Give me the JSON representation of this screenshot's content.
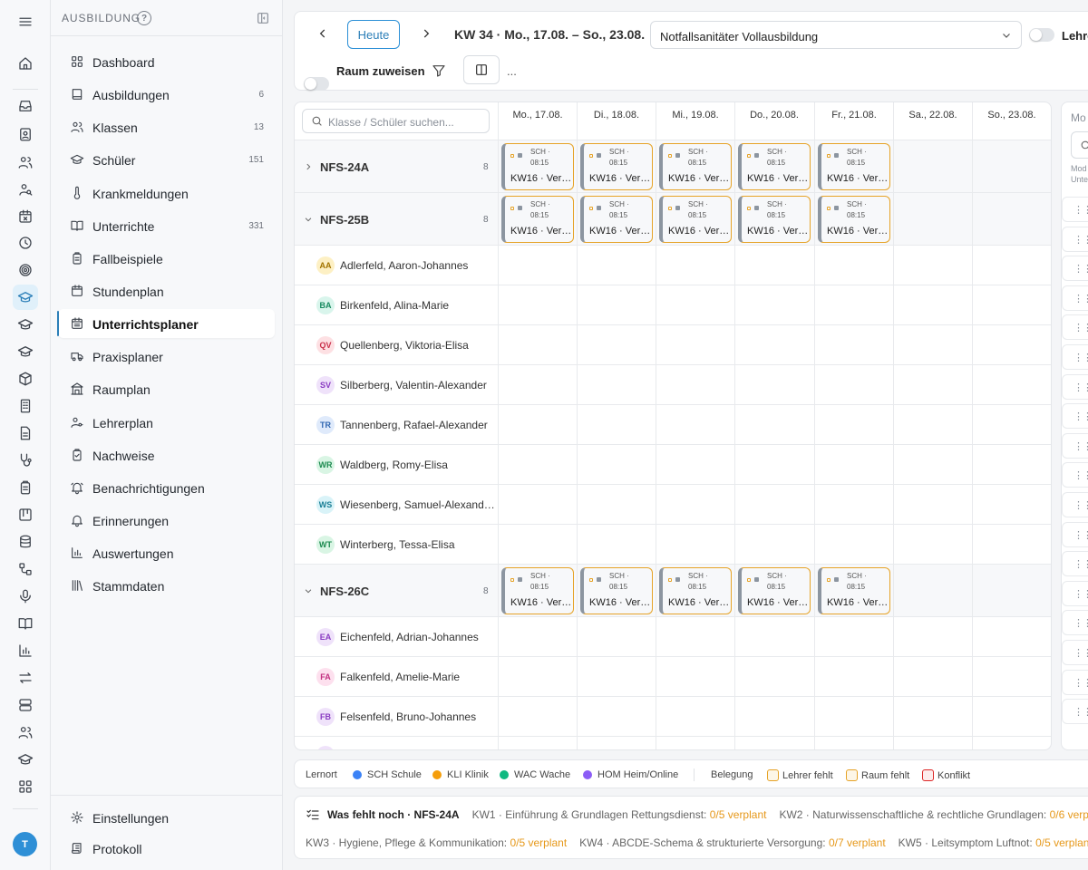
{
  "sidebar": {
    "title": "AUSBILDUNG",
    "items": [
      {
        "label": "Dashboard",
        "count": ""
      },
      {
        "label": "Ausbildungen",
        "count": "6"
      },
      {
        "label": "Klassen",
        "count": "13"
      },
      {
        "label": "Schüler",
        "count": "151"
      },
      {
        "label": "Krankmeldungen",
        "count": ""
      },
      {
        "label": "Unterrichte",
        "count": "331"
      },
      {
        "label": "Fallbeispiele",
        "count": ""
      },
      {
        "label": "Stundenplan",
        "count": ""
      },
      {
        "label": "Unterrichtsplaner",
        "count": ""
      },
      {
        "label": "Praxisplaner",
        "count": ""
      },
      {
        "label": "Raumplan",
        "count": ""
      },
      {
        "label": "Lehrerplan",
        "count": ""
      },
      {
        "label": "Nachweise",
        "count": ""
      },
      {
        "label": "Benachrichtigungen",
        "count": ""
      },
      {
        "label": "Erinnerungen",
        "count": ""
      },
      {
        "label": "Auswertungen",
        "count": ""
      },
      {
        "label": "Stammdaten",
        "count": ""
      }
    ],
    "footer": [
      {
        "label": "Einstellungen"
      },
      {
        "label": "Protokoll"
      }
    ]
  },
  "user": {
    "initial": "T"
  },
  "toolbar": {
    "today": "Heute",
    "week": "KW 34 · Mo., 17.08. – So., 23.08.",
    "course": "Notfallsanitäter Vollausbildung",
    "teacher_toggle": "Lehre",
    "room_toggle": "Raum zuweisen",
    "more": "..."
  },
  "grid": {
    "search_placeholder": "Klasse / Schüler suchen...",
    "days": [
      "Mo., 17.08.",
      "Di., 18.08.",
      "Mi., 19.08.",
      "Do., 20.08.",
      "Fr., 21.08.",
      "Sa., 22.08.",
      "So., 23.08."
    ],
    "chip": {
      "line1": "SCH ·",
      "line2": "08:15",
      "line3": "KW16 · Ver…"
    },
    "groups": [
      {
        "name": "NFS-24A",
        "count": "8",
        "expanded": false,
        "students": []
      },
      {
        "name": "NFS-25B",
        "count": "8",
        "expanded": true,
        "students": [
          {
            "initials": "AA",
            "name": "Adlerfeld, Aaron-Johannes",
            "bg": "#fdf0c4",
            "fg": "#a27400"
          },
          {
            "initials": "BA",
            "name": "Birkenfeld, Alina-Marie",
            "bg": "#d9f5ec",
            "fg": "#198a60"
          },
          {
            "initials": "QV",
            "name": "Quellenberg, Viktoria-Elisa",
            "bg": "#fde0e3",
            "fg": "#c9304a"
          },
          {
            "initials": "SV",
            "name": "Silberberg, Valentin-Alexander",
            "bg": "#efe2fa",
            "fg": "#8a3cc2"
          },
          {
            "initials": "TR",
            "name": "Tannenberg, Rafael-Alexander",
            "bg": "#dfeafb",
            "fg": "#2f66b0"
          },
          {
            "initials": "WR",
            "name": "Waldberg, Romy-Elisa",
            "bg": "#d9f5e4",
            "fg": "#1d8a50"
          },
          {
            "initials": "WS",
            "name": "Wiesenberg, Samuel-Alexand…",
            "bg": "#d9f3f8",
            "fg": "#1b7f96"
          },
          {
            "initials": "WT",
            "name": "Winterberg, Tessa-Elisa",
            "bg": "#d9f5e4",
            "fg": "#1d8a50"
          }
        ]
      },
      {
        "name": "NFS-26C",
        "count": "8",
        "expanded": true,
        "students": [
          {
            "initials": "EA",
            "name": "Eichenfeld, Adrian-Johannes",
            "bg": "#efe2fa",
            "fg": "#8a3cc2"
          },
          {
            "initials": "FA",
            "name": "Falkenfeld, Amelie-Marie",
            "bg": "#fde0ee",
            "fg": "#c23080"
          },
          {
            "initials": "FB",
            "name": "Felsenfeld, Bruno-Johannes",
            "bg": "#efe2fa",
            "fg": "#8a3cc2"
          }
        ]
      }
    ]
  },
  "right_panel": {
    "title": "Mo",
    "sub1": "Mod",
    "sub2": "Unte",
    "handle": "⋮⋮"
  },
  "legend": {
    "lernort": "Lernort",
    "sch": "SCH Schule",
    "kli": "KLI Klinik",
    "wac": "WAC Wache",
    "hom": "HOM Heim/Online",
    "belegung": "Belegung",
    "lehrer": "Lehrer fehlt",
    "raum": "Raum fehlt",
    "konflikt": "Konflikt",
    "colors": {
      "sch": "#3b82f6",
      "kli": "#f59e0b",
      "wac": "#10b981",
      "hom": "#8b5cf6",
      "warn": "#e6a327",
      "conflict": "#dc2626"
    }
  },
  "missing": {
    "title": "Was fehlt noch · NFS-24A",
    "row1": [
      {
        "label": "KW1 · Einführung & Grundlagen Rettungsdienst:",
        "value": "0/5 verplant"
      },
      {
        "label": "KW2 · Naturwissenschaftliche & rechtliche Grundlagen:",
        "value": "0/6 verplant"
      }
    ],
    "row2": [
      {
        "label": "KW3 · Hygiene, Pflege & Kommunikation:",
        "value": "0/5 verplant"
      },
      {
        "label": "KW4 · ABCDE-Schema & strukturierte Versorgung:",
        "value": "0/7 verplant"
      },
      {
        "label": "KW5 · Leitsymptom Luftnot:",
        "value": "0/5 verplant"
      }
    ]
  }
}
